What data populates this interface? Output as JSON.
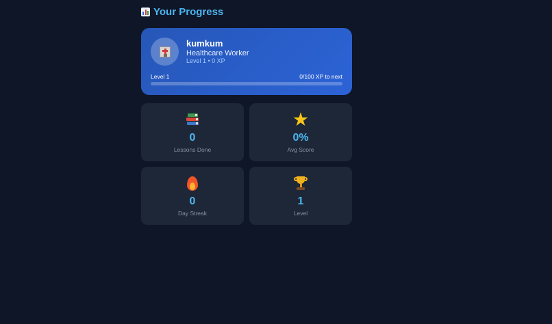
{
  "header": {
    "title": "Your Progress",
    "icon": "bar-chart-icon"
  },
  "profile": {
    "avatar_icon": "hospital-icon",
    "name": "kumkum",
    "role": "Healthcare Worker",
    "level_xp": "Level 1 • 0 XP",
    "level_label": "Level 1",
    "xp_to_next": "0/100 XP to next",
    "progress_fraction": 0
  },
  "stats": [
    {
      "icon": "books-icon",
      "value": "0",
      "label": "Lessons Done"
    },
    {
      "icon": "star-icon",
      "value": "0%",
      "label": "Avg Score"
    },
    {
      "icon": "fire-icon",
      "value": "0",
      "label": "Day Streak"
    },
    {
      "icon": "trophy-icon",
      "value": "1",
      "label": "Level"
    }
  ],
  "colors": {
    "background": "#0f1628",
    "accent": "#4db6ef",
    "card": "#1e2738",
    "profile_gradient_start": "#2657b8",
    "profile_gradient_end": "#2c63d6"
  }
}
